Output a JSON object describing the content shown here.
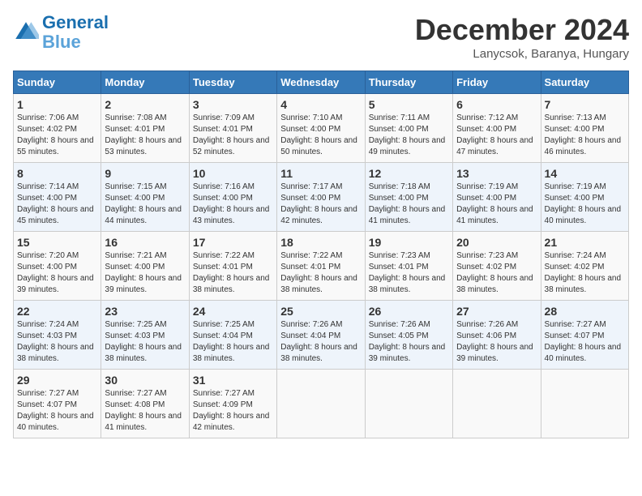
{
  "logo": {
    "line1": "General",
    "line2": "Blue"
  },
  "title": "December 2024",
  "subtitle": "Lanycsok, Baranya, Hungary",
  "days_of_week": [
    "Sunday",
    "Monday",
    "Tuesday",
    "Wednesday",
    "Thursday",
    "Friday",
    "Saturday"
  ],
  "weeks": [
    [
      {
        "day": "1",
        "sunrise": "7:06 AM",
        "sunset": "4:02 PM",
        "daylight": "8 hours and 55 minutes."
      },
      {
        "day": "2",
        "sunrise": "7:08 AM",
        "sunset": "4:01 PM",
        "daylight": "8 hours and 53 minutes."
      },
      {
        "day": "3",
        "sunrise": "7:09 AM",
        "sunset": "4:01 PM",
        "daylight": "8 hours and 52 minutes."
      },
      {
        "day": "4",
        "sunrise": "7:10 AM",
        "sunset": "4:00 PM",
        "daylight": "8 hours and 50 minutes."
      },
      {
        "day": "5",
        "sunrise": "7:11 AM",
        "sunset": "4:00 PM",
        "daylight": "8 hours and 49 minutes."
      },
      {
        "day": "6",
        "sunrise": "7:12 AM",
        "sunset": "4:00 PM",
        "daylight": "8 hours and 47 minutes."
      },
      {
        "day": "7",
        "sunrise": "7:13 AM",
        "sunset": "4:00 PM",
        "daylight": "8 hours and 46 minutes."
      }
    ],
    [
      {
        "day": "8",
        "sunrise": "7:14 AM",
        "sunset": "4:00 PM",
        "daylight": "8 hours and 45 minutes."
      },
      {
        "day": "9",
        "sunrise": "7:15 AM",
        "sunset": "4:00 PM",
        "daylight": "8 hours and 44 minutes."
      },
      {
        "day": "10",
        "sunrise": "7:16 AM",
        "sunset": "4:00 PM",
        "daylight": "8 hours and 43 minutes."
      },
      {
        "day": "11",
        "sunrise": "7:17 AM",
        "sunset": "4:00 PM",
        "daylight": "8 hours and 42 minutes."
      },
      {
        "day": "12",
        "sunrise": "7:18 AM",
        "sunset": "4:00 PM",
        "daylight": "8 hours and 41 minutes."
      },
      {
        "day": "13",
        "sunrise": "7:19 AM",
        "sunset": "4:00 PM",
        "daylight": "8 hours and 41 minutes."
      },
      {
        "day": "14",
        "sunrise": "7:19 AM",
        "sunset": "4:00 PM",
        "daylight": "8 hours and 40 minutes."
      }
    ],
    [
      {
        "day": "15",
        "sunrise": "7:20 AM",
        "sunset": "4:00 PM",
        "daylight": "8 hours and 39 minutes."
      },
      {
        "day": "16",
        "sunrise": "7:21 AM",
        "sunset": "4:00 PM",
        "daylight": "8 hours and 39 minutes."
      },
      {
        "day": "17",
        "sunrise": "7:22 AM",
        "sunset": "4:01 PM",
        "daylight": "8 hours and 38 minutes."
      },
      {
        "day": "18",
        "sunrise": "7:22 AM",
        "sunset": "4:01 PM",
        "daylight": "8 hours and 38 minutes."
      },
      {
        "day": "19",
        "sunrise": "7:23 AM",
        "sunset": "4:01 PM",
        "daylight": "8 hours and 38 minutes."
      },
      {
        "day": "20",
        "sunrise": "7:23 AM",
        "sunset": "4:02 PM",
        "daylight": "8 hours and 38 minutes."
      },
      {
        "day": "21",
        "sunrise": "7:24 AM",
        "sunset": "4:02 PM",
        "daylight": "8 hours and 38 minutes."
      }
    ],
    [
      {
        "day": "22",
        "sunrise": "7:24 AM",
        "sunset": "4:03 PM",
        "daylight": "8 hours and 38 minutes."
      },
      {
        "day": "23",
        "sunrise": "7:25 AM",
        "sunset": "4:03 PM",
        "daylight": "8 hours and 38 minutes."
      },
      {
        "day": "24",
        "sunrise": "7:25 AM",
        "sunset": "4:04 PM",
        "daylight": "8 hours and 38 minutes."
      },
      {
        "day": "25",
        "sunrise": "7:26 AM",
        "sunset": "4:04 PM",
        "daylight": "8 hours and 38 minutes."
      },
      {
        "day": "26",
        "sunrise": "7:26 AM",
        "sunset": "4:05 PM",
        "daylight": "8 hours and 39 minutes."
      },
      {
        "day": "27",
        "sunrise": "7:26 AM",
        "sunset": "4:06 PM",
        "daylight": "8 hours and 39 minutes."
      },
      {
        "day": "28",
        "sunrise": "7:27 AM",
        "sunset": "4:07 PM",
        "daylight": "8 hours and 40 minutes."
      }
    ],
    [
      {
        "day": "29",
        "sunrise": "7:27 AM",
        "sunset": "4:07 PM",
        "daylight": "8 hours and 40 minutes."
      },
      {
        "day": "30",
        "sunrise": "7:27 AM",
        "sunset": "4:08 PM",
        "daylight": "8 hours and 41 minutes."
      },
      {
        "day": "31",
        "sunrise": "7:27 AM",
        "sunset": "4:09 PM",
        "daylight": "8 hours and 42 minutes."
      },
      null,
      null,
      null,
      null
    ]
  ],
  "labels": {
    "sunrise": "Sunrise:",
    "sunset": "Sunset:",
    "daylight": "Daylight:"
  }
}
